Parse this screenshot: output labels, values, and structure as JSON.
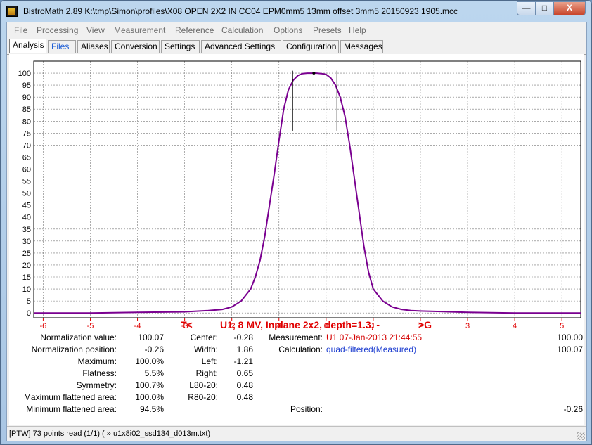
{
  "window": {
    "title": "BistroMath 2.89   K:\\tmp\\Simon\\profiles\\X08 OPEN 2X2 IN CC04 EPM0mm5 13mm offset 3mm5 20150923 1905.mcc",
    "minimize_label": "—",
    "maximize_label": "□",
    "close_label": "X"
  },
  "menu": [
    "File",
    "Processing",
    "View",
    "Measurement",
    "Reference",
    "Calculation",
    "Options",
    "Presets",
    "Help"
  ],
  "tabs": [
    "Analysis",
    "Files",
    "Aliases",
    "Conversion",
    "Settings",
    "Advanced Settings",
    "Configuration",
    "Messages"
  ],
  "chart_data": {
    "type": "line",
    "title": "U1, 8 MV, Inplane 2x2, depth=1.3, -",
    "left_marker": "T<",
    "right_marker": ">G",
    "xlim": [
      -6.2,
      5.4
    ],
    "ylim": [
      -2,
      105
    ],
    "x_ticks": [
      -6,
      -5,
      -4,
      -3,
      -2,
      -1,
      0,
      1,
      2,
      3,
      4,
      5
    ],
    "y_ticks": [
      0,
      5,
      10,
      15,
      20,
      25,
      30,
      35,
      40,
      45,
      50,
      55,
      60,
      65,
      70,
      75,
      80,
      85,
      90,
      95,
      100
    ],
    "grid": true,
    "tick_color": "#e00000",
    "series": [
      {
        "color": "#7a0090",
        "x": [
          -6.2,
          -5,
          -4,
          -3,
          -2.5,
          -2.2,
          -2.0,
          -1.8,
          -1.6,
          -1.5,
          -1.4,
          -1.3,
          -1.2,
          -1.1,
          -1.0,
          -0.9,
          -0.8,
          -0.7,
          -0.6,
          -0.5,
          -0.4,
          -0.3,
          -0.2,
          -0.1,
          0.0,
          0.1,
          0.2,
          0.3,
          0.4,
          0.5,
          0.6,
          0.7,
          0.8,
          0.9,
          1.0,
          1.2,
          1.4,
          1.6,
          1.8,
          2.0,
          3,
          4,
          5,
          5.4
        ],
        "y": [
          0,
          0,
          0.3,
          0.5,
          1,
          1.5,
          2.5,
          5,
          10,
          15,
          22,
          32,
          45,
          58,
          72,
          85,
          93,
          97,
          99,
          99.8,
          100,
          100,
          100,
          99.8,
          99.5,
          98,
          95,
          90,
          82,
          70,
          56,
          42,
          28,
          17,
          10,
          5,
          2.5,
          1.5,
          1,
          0.8,
          0.3,
          0,
          0,
          0
        ]
      }
    ],
    "vertical_markers": [
      {
        "x": -0.71,
        "y_top": 101,
        "y_bottom": 76
      },
      {
        "x": 0.23,
        "y_top": 101,
        "y_bottom": 76
      }
    ],
    "peak_marker": {
      "x": -0.26,
      "y": 100
    }
  },
  "stats": {
    "normalization_value": {
      "label": "Normalization value:",
      "value": "100.07"
    },
    "normalization_position": {
      "label": "Normalization position:",
      "value": "-0.26"
    },
    "maximum": {
      "label": "Maximum:",
      "value": "100.0%"
    },
    "flatness": {
      "label": "Flatness:",
      "value": "5.5%"
    },
    "symmetry": {
      "label": "Symmetry:",
      "value": "100.7%"
    },
    "max_flattened": {
      "label": "Maximum flattened area:",
      "value": "100.0%"
    },
    "min_flattened": {
      "label": "Minimum flattened area:",
      "value": "94.5%"
    },
    "center": {
      "label": "Center:",
      "value": "-0.28"
    },
    "width": {
      "label": "Width:",
      "value": "1.86"
    },
    "left": {
      "label": "Left:",
      "value": "-1.21"
    },
    "right": {
      "label": "Right:",
      "value": "0.65"
    },
    "l80_20": {
      "label": "L80-20:",
      "value": "0.48"
    },
    "r80_20": {
      "label": "R80-20:",
      "value": "0.48"
    },
    "measurement": {
      "label": "Measurement:",
      "value": "U1 07-Jan-2013 21:44:55",
      "right": "100.00"
    },
    "calculation": {
      "label": "Calculation:",
      "value": "quad-filtered(Measured)",
      "right": "100.07"
    },
    "position": {
      "label": "Position:",
      "right": "-0.26"
    }
  },
  "status_bar": "[PTW] 73 points read (1/1) ( » u1x8i02_ssd134_d013m.txt)"
}
